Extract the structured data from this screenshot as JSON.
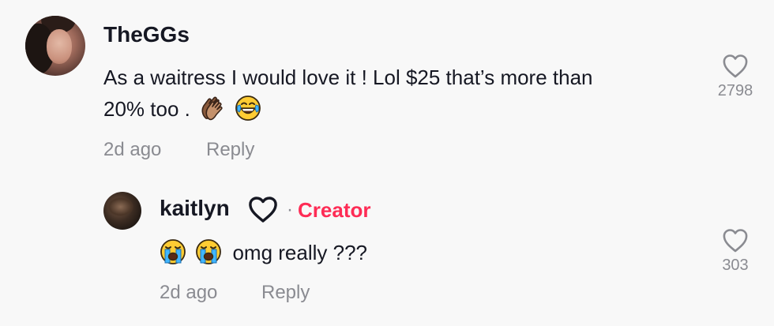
{
  "comment": {
    "username": "TheGGs",
    "text_line1": "As a waitress I would love it ! Lol $25 that’s more than",
    "text_line2": "20% too .",
    "emojis": [
      "clapping-hands-icon",
      "tears-of-joy-icon"
    ],
    "time": "2d ago",
    "reply_label": "Reply",
    "like_icon": "heart-outline-icon",
    "like_count": "2798"
  },
  "reply": {
    "username": "kaitlyn",
    "username_icon": "heart-outline-icon",
    "separator": "·",
    "badge": "Creator",
    "emojis": [
      "loudly-crying-icon",
      "loudly-crying-icon"
    ],
    "text": "omg really ???",
    "time": "2d ago",
    "reply_label": "Reply",
    "like_icon": "heart-outline-icon",
    "like_count": "303"
  },
  "colors": {
    "background": "#f8f8f8",
    "text": "#161823",
    "muted": "#8a8b91",
    "creator": "#fe2c55"
  }
}
